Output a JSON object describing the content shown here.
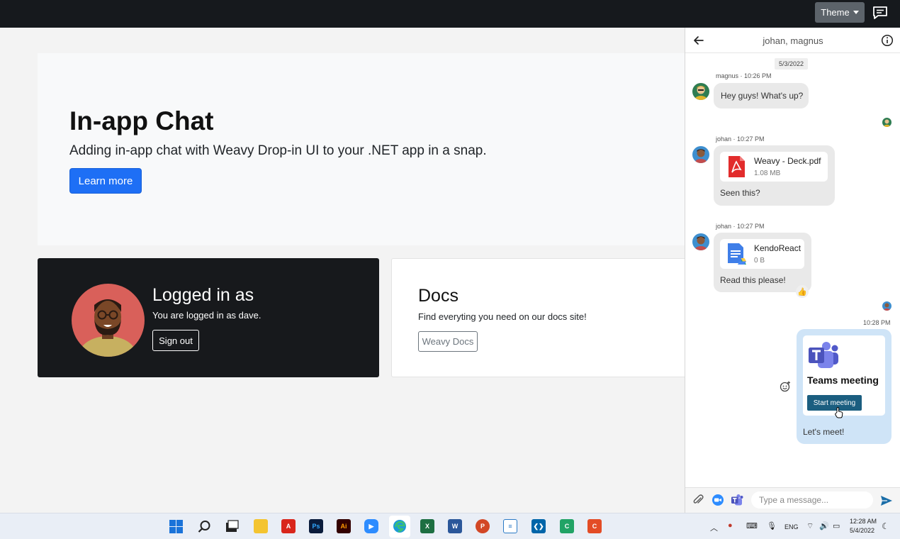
{
  "navbar": {
    "theme_label": "Theme"
  },
  "hero": {
    "title": "In-app Chat",
    "subtitle": "Adding in-app chat with Weavy Drop-in UI to your .NET app in a snap.",
    "button": "Learn more"
  },
  "login_card": {
    "title": "Logged in as",
    "text": "You are logged in as dave.",
    "button": "Sign out"
  },
  "docs_card": {
    "title": "Docs",
    "text": "Find everyting you need on our docs site!",
    "button": "Weavy Docs"
  },
  "chat": {
    "title": "johan, magnus",
    "date": "5/3/2022",
    "messages": [
      {
        "meta": "magnus · 10:26 PM",
        "text": "Hey guys! What's up?"
      },
      {
        "meta": "johan · 10:27 PM",
        "file_name": "Weavy - Deck.pdf",
        "file_size": "1.08 MB",
        "text": "Seen this?"
      },
      {
        "meta": "johan · 10:27 PM",
        "file_name": "KendoReact",
        "file_size": "0 B",
        "text": "Read this please!",
        "reaction": "👍"
      }
    ],
    "own_message": {
      "time": "10:28 PM",
      "card_title": "Teams meeting",
      "button": "Start meeting",
      "text": "Let's meet!"
    },
    "composer": {
      "placeholder": "Type a message..."
    }
  },
  "taskbar": {
    "lang": "ENG",
    "time": "12:28 AM",
    "date": "5/4/2022"
  },
  "colors": {
    "navbar": "#16191d",
    "primary": "#1e6ff5",
    "teams_button": "#1b5e80",
    "own_bubble": "#cfe4f7"
  }
}
